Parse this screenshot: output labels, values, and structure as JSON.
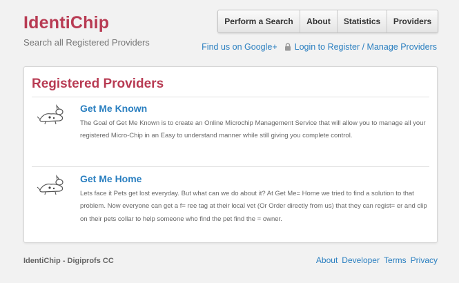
{
  "header": {
    "brand": "IdentiChip",
    "tagline": "Search all Registered Providers"
  },
  "nav": {
    "items": [
      "Perform a Search",
      "About",
      "Statistics",
      "Providers"
    ]
  },
  "links": {
    "google": "Find us on Google+",
    "login": "Login to Register / Manage Providers"
  },
  "main": {
    "title": "Registered Providers",
    "providers": [
      {
        "name": "Get Me Known",
        "description": "The Goal of Get Me Known is to create an Online Microchip Management Service that will allow you to manage all your registered Micro-Chip in an Easy to understand manner while still giving you complete control.",
        "icon": "sleeping-dog-icon"
      },
      {
        "name": "Get Me Home",
        "description": "Lets face it Pets get lost everyday. But what can we do about it? At Get Me= Home we tried to find a solution to that problem. Now everyone can get a f= ree tag at their local vet (Or Order directly from us) that they can regist= er and clip on their pets collar to help someone who find the pet find the = owner.",
        "icon": "sleeping-dog-icon"
      }
    ]
  },
  "footer": {
    "copyright": "IdentiChip - Digiprofs CC",
    "links": [
      "About",
      "Developer",
      "Terms",
      "Privacy"
    ]
  },
  "colors": {
    "brand": "#b83b53",
    "link": "#2a7fc0",
    "background": "#f2f2f2"
  }
}
